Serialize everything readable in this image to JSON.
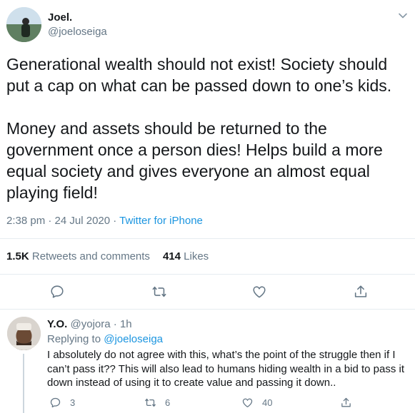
{
  "tweet": {
    "author_name": "Joel.",
    "author_handle": "@joeloseiga",
    "text": "Generational wealth should not exist! Society should put a cap on what can be passed down to one’s kids.\n\nMoney and assets should be returned to the government once a person dies! Helps build a more equal society and gives everyone an almost equal playing field!",
    "time": "2:38 pm · 24 Jul 2020 · ",
    "source": "Twitter for iPhone",
    "retweets_count": "1.5K",
    "retweets_label": "Retweets and comments",
    "likes_count": "414",
    "likes_label": "Likes"
  },
  "reply": {
    "author_name": "Y.O.",
    "author_handle": "@yojora",
    "separator": " · ",
    "age": "1h",
    "replying_prefix": "Replying to ",
    "replying_handle": "@joeloseiga",
    "text": "I absolutely do not agree with this, what’s the point of the struggle then if I can’t pass it?? This will also lead to humans hiding wealth in a bid to pass it down instead of using it to create value and passing it down..",
    "reply_count": "3",
    "retweet_count": "6",
    "like_count": "40"
  },
  "colors": {
    "accent": "#1b95e0",
    "secondary_text": "#657786",
    "primary_text": "#14171a",
    "divider": "#e6ecf0"
  },
  "icons": [
    "chevron-down-icon",
    "reply-icon",
    "retweet-icon",
    "like-icon",
    "share-icon"
  ]
}
